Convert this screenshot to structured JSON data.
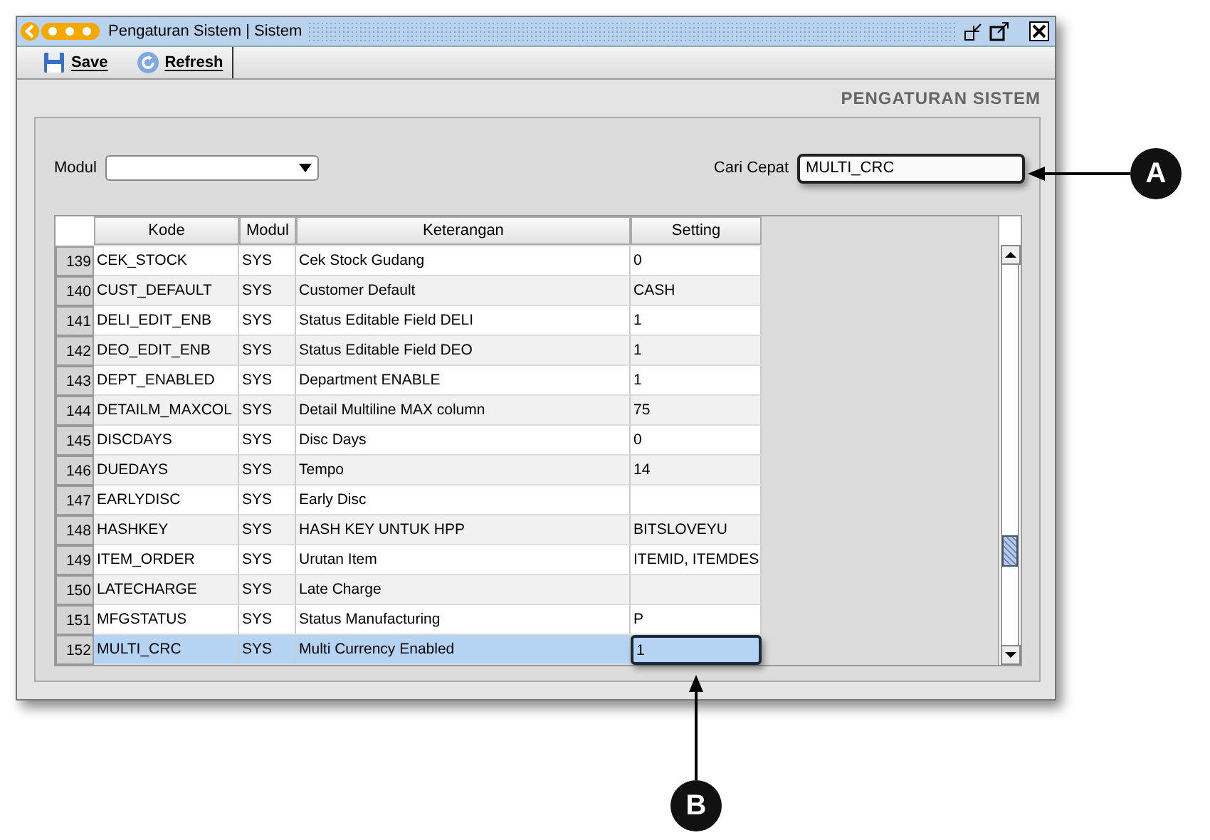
{
  "window": {
    "title": "Pengaturan Sistem | Sistem"
  },
  "toolbar": [
    {
      "kind": "save",
      "label": "Save"
    },
    {
      "kind": "refresh",
      "label": "Refresh"
    }
  ],
  "heading": "PENGATURAN SISTEM",
  "filter": {
    "modul_label": "Modul",
    "search_label": "Cari Cepat",
    "search_value": "MULTI_CRC"
  },
  "table": {
    "columns": [
      "Kode",
      "Modul",
      "Keterangan",
      "Setting"
    ],
    "rows": [
      {
        "no": "139",
        "kode": "CEK_STOCK",
        "modul": "SYS",
        "keterangan": "Cek Stock Gudang",
        "setting": "0",
        "selected": false
      },
      {
        "no": "140",
        "kode": "CUST_DEFAULT",
        "modul": "SYS",
        "keterangan": "Customer Default",
        "setting": "CASH",
        "selected": false
      },
      {
        "no": "141",
        "kode": "DELI_EDIT_ENB",
        "modul": "SYS",
        "keterangan": "Status Editable Field DELI",
        "setting": "1",
        "selected": false
      },
      {
        "no": "142",
        "kode": "DEO_EDIT_ENB",
        "modul": "SYS",
        "keterangan": "Status Editable Field DEO",
        "setting": "1",
        "selected": false
      },
      {
        "no": "143",
        "kode": "DEPT_ENABLED",
        "modul": "SYS",
        "keterangan": "Department ENABLE",
        "setting": "1",
        "selected": false
      },
      {
        "no": "144",
        "kode": "DETAILM_MAXCOL",
        "modul": "SYS",
        "keterangan": "Detail Multiline MAX column",
        "setting": "75",
        "selected": false
      },
      {
        "no": "145",
        "kode": "DISCDAYS",
        "modul": "SYS",
        "keterangan": "Disc Days",
        "setting": "0",
        "selected": false
      },
      {
        "no": "146",
        "kode": "DUEDAYS",
        "modul": "SYS",
        "keterangan": "Tempo",
        "setting": "14",
        "selected": false
      },
      {
        "no": "147",
        "kode": "EARLYDISC",
        "modul": "SYS",
        "keterangan": "Early Disc",
        "setting": "",
        "selected": false
      },
      {
        "no": "148",
        "kode": "HASHKEY",
        "modul": "SYS",
        "keterangan": "HASH KEY UNTUK HPP",
        "setting": "BITSLOVEYU",
        "selected": false
      },
      {
        "no": "149",
        "kode": "ITEM_ORDER",
        "modul": "SYS",
        "keterangan": "Urutan Item",
        "setting": "ITEMID, ITEMDES",
        "selected": false
      },
      {
        "no": "150",
        "kode": "LATECHARGE",
        "modul": "SYS",
        "keterangan": "Late Charge",
        "setting": "",
        "selected": false
      },
      {
        "no": "151",
        "kode": "MFGSTATUS",
        "modul": "SYS",
        "keterangan": "Status Manufacturing",
        "setting": "P",
        "selected": false
      },
      {
        "no": "152",
        "kode": "MULTI_CRC",
        "modul": "SYS",
        "keterangan": "Multi Currency Enabled",
        "setting": "1",
        "selected": true
      }
    ]
  },
  "callouts": [
    {
      "label": "A"
    },
    {
      "label": "B"
    }
  ]
}
